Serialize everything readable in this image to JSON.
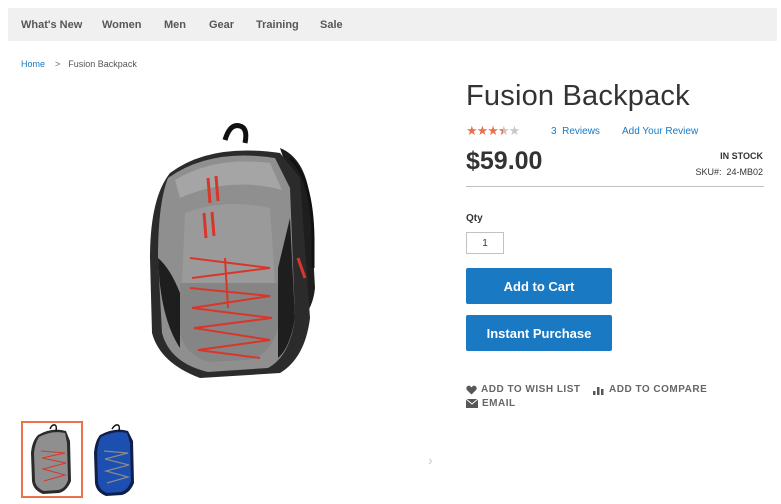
{
  "nav": {
    "items": [
      {
        "label": "What's New"
      },
      {
        "label": "Women"
      },
      {
        "label": "Men"
      },
      {
        "label": "Gear"
      },
      {
        "label": "Training"
      },
      {
        "label": "Sale"
      }
    ]
  },
  "breadcrumb": {
    "home": "Home",
    "separator": ">",
    "current": "Fusion Backpack"
  },
  "product": {
    "title": "Fusion Backpack",
    "rating": {
      "filled": "★★★",
      "half": "★",
      "empty": "★",
      "value": 3.5,
      "max": 5
    },
    "reviews_count": "3",
    "reviews_label": "Reviews",
    "add_review": "Add Your Review",
    "price": "$59.00",
    "stock": "IN STOCK",
    "sku_label": "SKU#:",
    "sku_value": "24-MB02",
    "qty_label": "Qty",
    "qty_value": "1",
    "add_to_cart": "Add to Cart",
    "instant_purchase": "Instant Purchase",
    "wishlist": "ADD TO WISH LIST",
    "compare": "ADD TO COMPARE",
    "email": "EMAIL"
  },
  "gallery": {
    "next_arrow": "›"
  },
  "colors": {
    "accent": "#1979c3",
    "star": "#e9724c",
    "nav_bg": "#f0f0f0"
  },
  "icons": {
    "wishlist": "heart-icon",
    "compare": "bar-chart-icon",
    "email": "envelope-icon"
  }
}
